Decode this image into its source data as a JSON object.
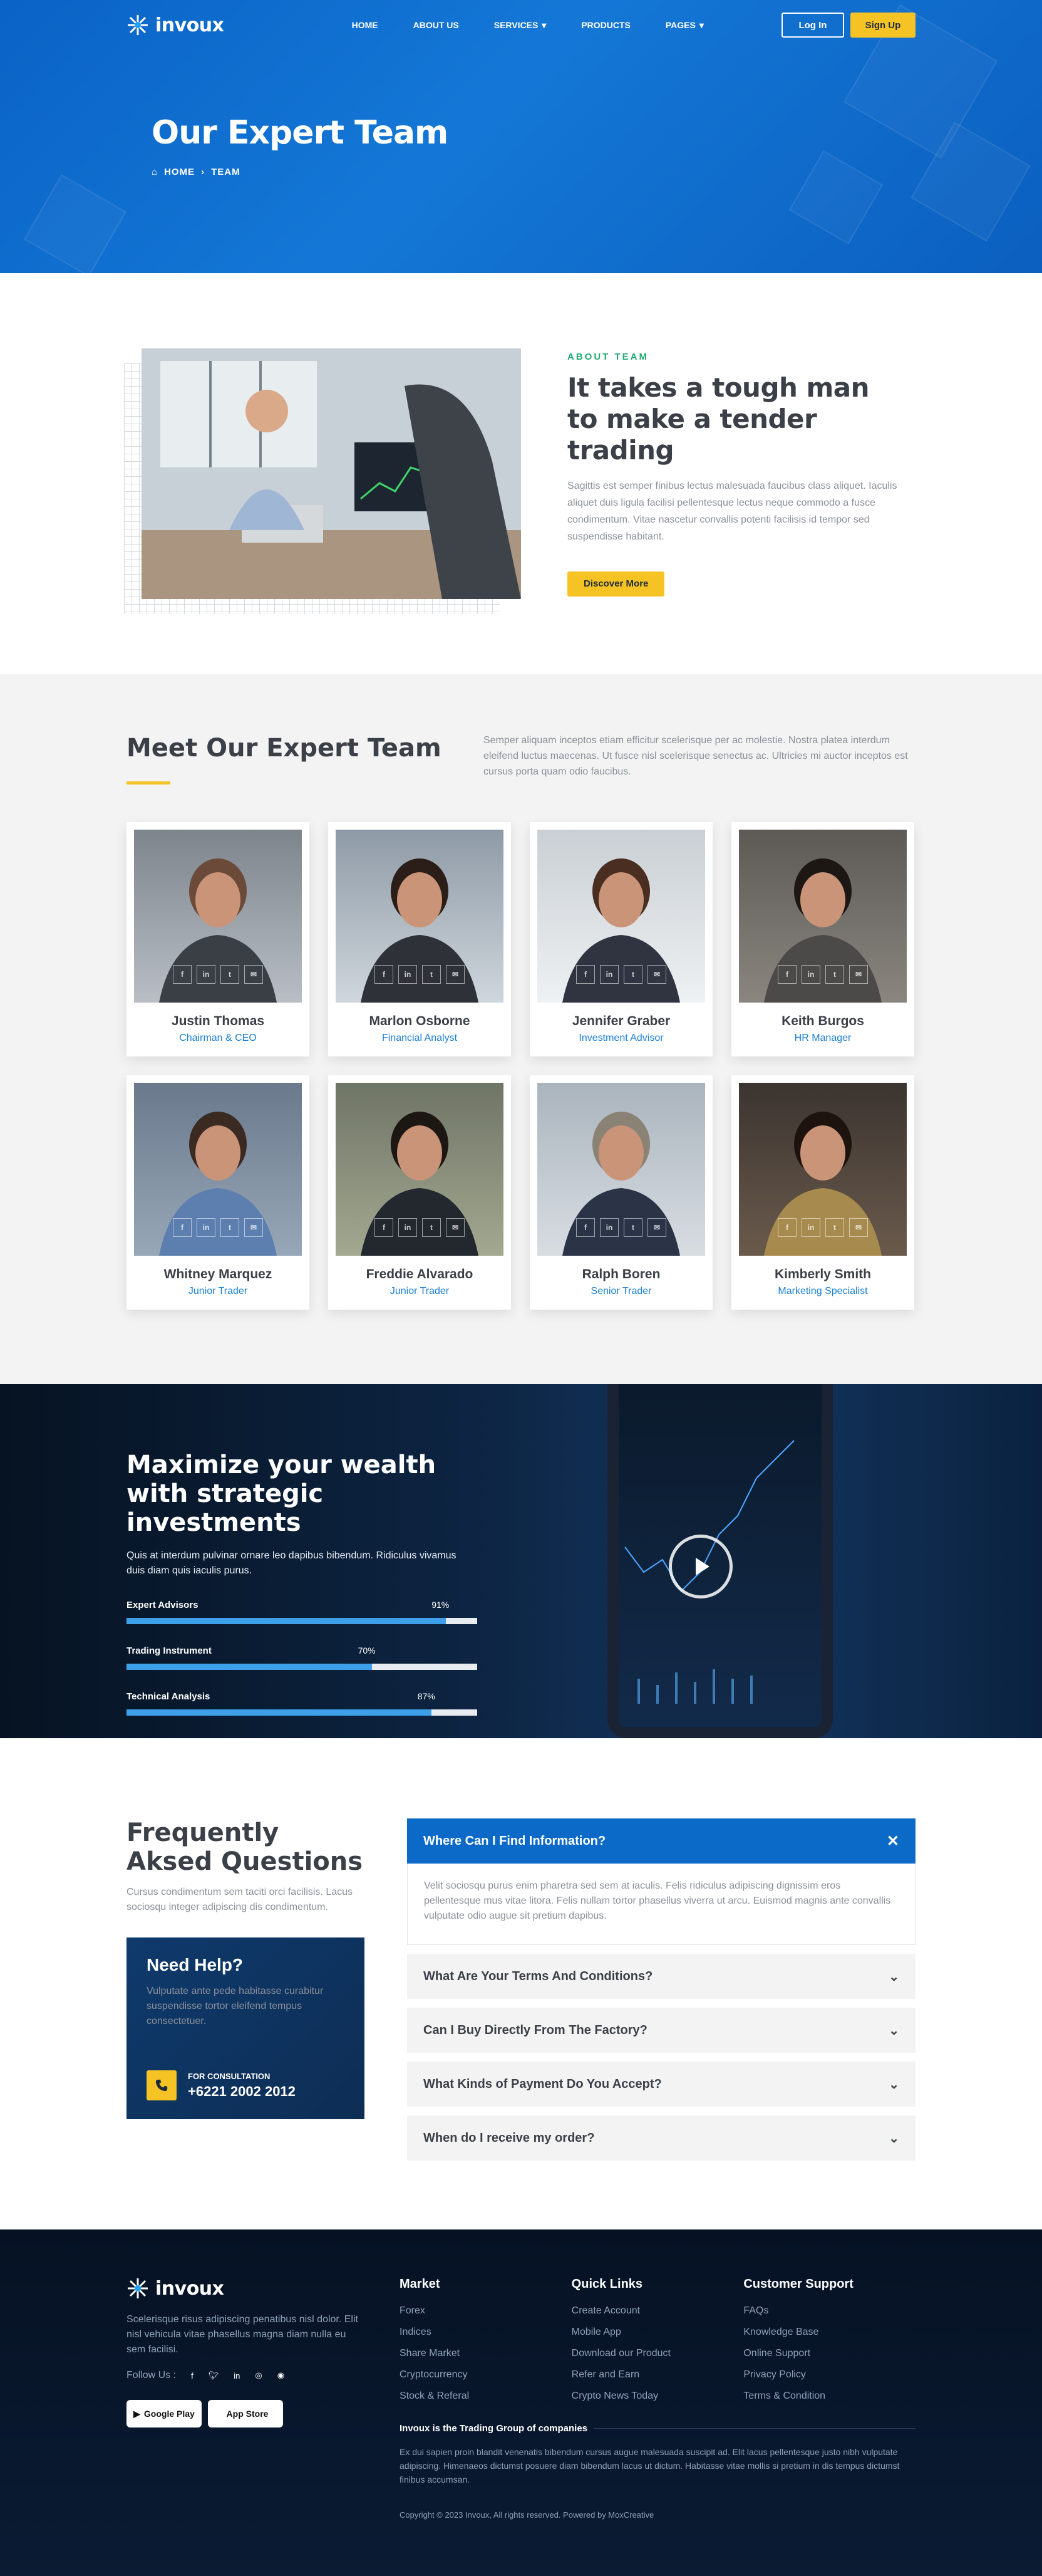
{
  "brand": {
    "name": "invoux"
  },
  "nav": {
    "items": [
      "HOME",
      "ABOUT US",
      "SERVICES",
      "PRODUCTS",
      "PAGES"
    ],
    "login": "Log In",
    "signup": "Sign Up"
  },
  "hero": {
    "title": "Our Expert Team",
    "crumb_home": "HOME",
    "crumb_current": "TEAM"
  },
  "about": {
    "eyebrow": "ABOUT TEAM",
    "title": "It takes a tough man to make a tender trading",
    "text": "Sagittis est semper finibus lectus malesuada faucibus class aliquet. Iaculis aliquet duis ligula facilisi pellentesque lectus neque commodo a fusce condimentum. Vitae nascetur convallis potenti facilisis id tempor sed suspendisse habitant.",
    "button": "Discover More"
  },
  "team": {
    "title": "Meet Our Expert Team",
    "text": "Semper aliquam inceptos etiam efficitur scelerisque per ac molestie. Nostra platea interdum eleifend luctus maecenas. Ut fusce nisl scelerisque senectus ac. Ultricies mi auctor inceptos est cursus porta quam odio faucibus.",
    "members": [
      {
        "name": "Justin Thomas",
        "role": "Chairman & CEO"
      },
      {
        "name": "Marlon Osborne",
        "role": "Financial Analyst"
      },
      {
        "name": "Jennifer Graber",
        "role": "Investment Advisor"
      },
      {
        "name": "Keith Burgos",
        "role": "HR Manager"
      },
      {
        "name": "Whitney Marquez",
        "role": "Junior Trader"
      },
      {
        "name": "Freddie Alvarado",
        "role": "Junior Trader"
      },
      {
        "name": "Ralph Boren",
        "role": "Senior Trader"
      },
      {
        "name": "Kimberly Smith",
        "role": "Marketing Specialist"
      }
    ]
  },
  "invest": {
    "title": "Maximize your wealth with strategic investments",
    "text": "Quis at interdum pulvinar ornare leo dapibus bibendum. Ridiculus vivamus duis diam quis iaculis purus.",
    "skills": [
      {
        "label": "Expert Advisors",
        "pct": "91%",
        "value": 0.91
      },
      {
        "label": "Trading Instrument",
        "pct": "70%",
        "value": 0.7
      },
      {
        "label": "Technical Analysis",
        "pct": "87%",
        "value": 0.87
      }
    ]
  },
  "faq": {
    "title": "Frequently Aksed Questions",
    "text": "Cursus condimentum sem taciti orci facilisis. Lacus sociosqu integer adipiscing dis condimentum.",
    "help_title": "Need Help?",
    "help_text": "Vulputate ante pede habitasse curabitur suspendisse tortor eleifend tempus consectetuer.",
    "consult_label": "FOR CONSULTATION",
    "consult_phone": "+6221 2002 2012",
    "items": [
      {
        "q": "Where Can I Find Information?",
        "a": "Velit sociosqu purus enim pharetra sed sem at iaculis. Felis ridiculus adipiscing dignissim eros pellentesque mus vitae litora. Felis nullam tortor phasellus viverra ut arcu. Euismod magnis ante convallis vulputate odio augue sit pretium dapibus."
      },
      {
        "q": "What Are Your Terms And Conditions?"
      },
      {
        "q": "Can I Buy Directly From The Factory?"
      },
      {
        "q": "What Kinds of Payment Do You Accept?"
      },
      {
        "q": "When do I receive my order?"
      }
    ]
  },
  "footer": {
    "about": "Scelerisque risus adipiscing penatibus nisl dolor. Elit nisl vehicula vitae phasellus magna diam nulla eu sem facilisi.",
    "follow": "Follow Us :",
    "google_play": "Google Play",
    "app_store": "App Store",
    "cols": [
      {
        "title": "Market",
        "links": [
          "Forex",
          "Indices",
          "Share Market",
          "Cryptocurrency",
          "Stock & Referal"
        ]
      },
      {
        "title": "Quick Links",
        "links": [
          "Create Account",
          "Mobile App",
          "Download our Product",
          "Refer and Earn",
          "Crypto News Today"
        ]
      },
      {
        "title": "Customer Support",
        "links": [
          "FAQs",
          "Knowledge Base",
          "Online Support",
          "Privacy Policy",
          "Terms & Condition"
        ]
      }
    ],
    "group_title": "Invoux is the Trading Group of companies",
    "group_text": "Ex dui sapien proin blandit venenatis bibendum cursus augue malesuada suscipit ad. Elit lacus pellentesque justo nibh vulputate adipiscing. Himenaeos dictumst posuere diam bibendum lacus ut dictum. Habitasse vitae mollis si pretium in dis tempus dictumst finibus accumsan.",
    "copyright": "Copyright © 2023 Invoux, All rights reserved. Powered by MoxCreative"
  },
  "colors": {
    "primary": "#0b6ac8",
    "accent": "#f6c324",
    "green": "#1fa971",
    "dark": "#061224"
  }
}
